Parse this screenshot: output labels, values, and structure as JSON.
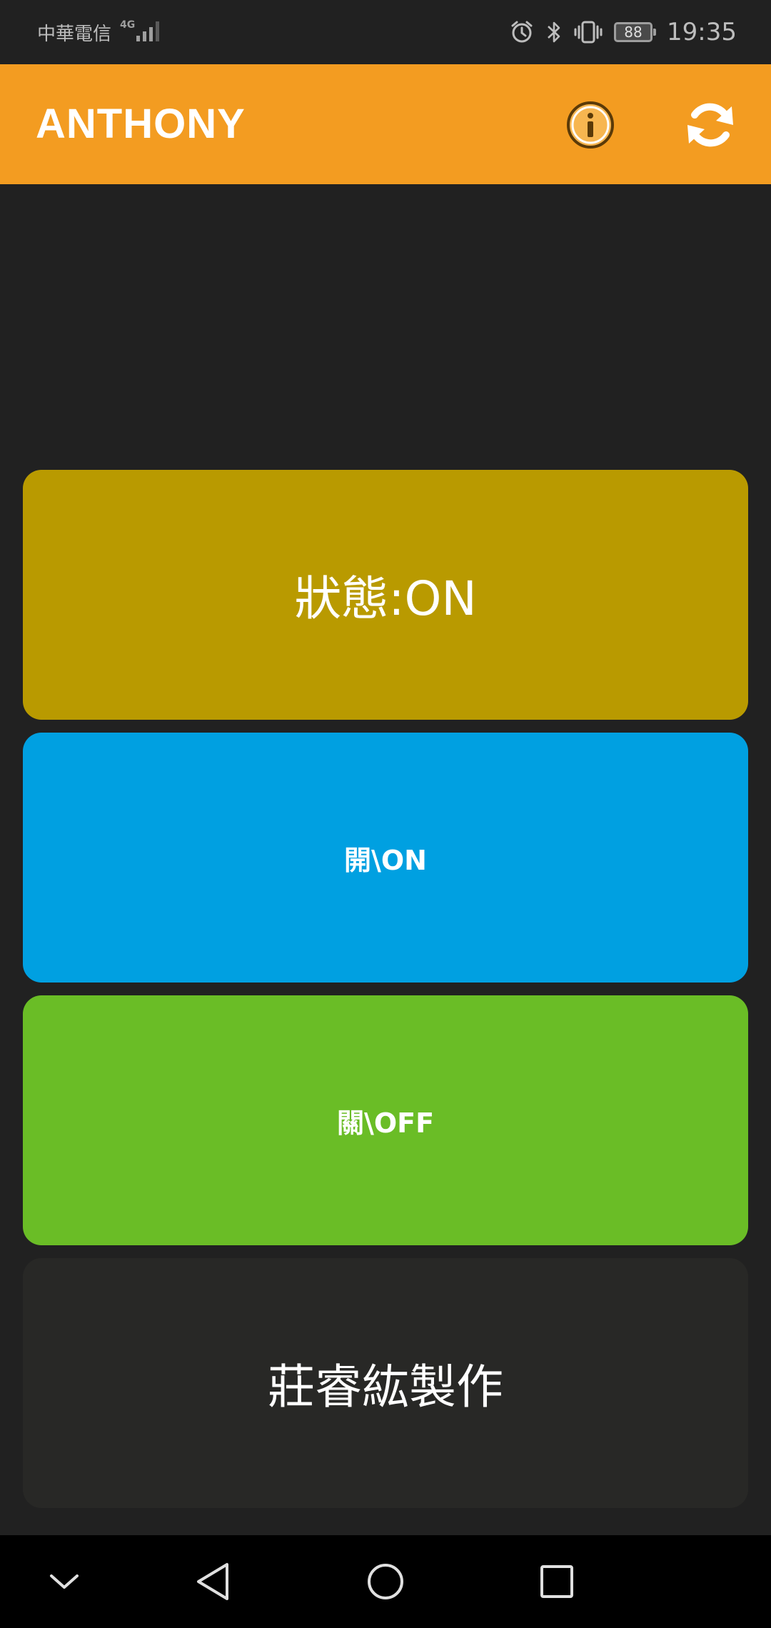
{
  "status_bar": {
    "carrier": "中華電信",
    "network": "4G",
    "battery": "88",
    "time": "19:35",
    "icons": [
      "signal-icon",
      "alarm-icon",
      "bluetooth-icon",
      "vibrate-icon",
      "battery-icon"
    ]
  },
  "app_bar": {
    "title": "ANTHONY",
    "info_icon": "info-icon",
    "refresh_icon": "refresh-icon"
  },
  "tiles": {
    "status_label": "狀態:ON",
    "on_button": "開\\ON",
    "off_button": "關\\OFF",
    "credit": "莊睿紘製作"
  },
  "nav_bar": {
    "icons": [
      "chevron-down-icon",
      "back-icon",
      "home-icon",
      "recents-icon"
    ]
  },
  "colors": {
    "app_bar": "#f39c21",
    "status_tile": "#b99a00",
    "on_tile": "#00a0e1",
    "off_tile": "#6abd26",
    "credit_tile": "#282826",
    "background": "#212121"
  }
}
